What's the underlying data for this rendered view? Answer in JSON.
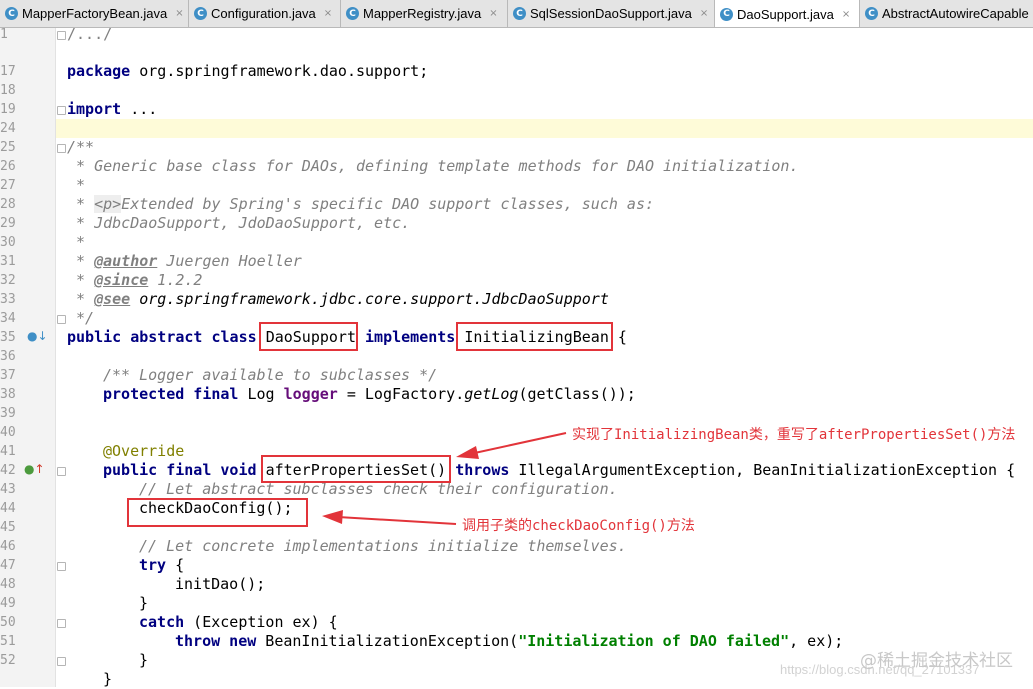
{
  "tabs": [
    {
      "label": "MapperFactoryBean.java",
      "icon": "C",
      "close": "×"
    },
    {
      "label": "Configuration.java",
      "icon": "C",
      "close": "×"
    },
    {
      "label": "MapperRegistry.java",
      "icon": "C",
      "close": "×"
    },
    {
      "label": "SqlSessionDaoSupport.java",
      "icon": "C",
      "close": "×"
    },
    {
      "label": "DaoSupport.java",
      "icon": "C",
      "close": "×"
    },
    {
      "label": "AbstractAutowireCapable",
      "icon": "C",
      "close": ""
    }
  ],
  "active_tab": "DaoSupport.java",
  "line_numbers": [
    "1",
    "17",
    "18",
    "19",
    "24",
    "25",
    "26",
    "27",
    "28",
    "29",
    "30",
    "31",
    "32",
    "33",
    "34",
    "35",
    "36",
    "37",
    "38",
    "39",
    "40",
    "41",
    "42",
    "43",
    "44",
    "45",
    "46",
    "47",
    "48",
    "49",
    "50",
    "51",
    "52"
  ],
  "code": {
    "l1": "/.../",
    "l17_kw": "package",
    "l17_rest": " org.springframework.dao.support;",
    "l19_kw": "import",
    "l19_rest": " ...",
    "l25": "/**",
    "l26": " * Generic base class for DAOs, defining template methods for DAO initialization.",
    "l27": " *",
    "l28_a": " * ",
    "l28_tag": "<p>",
    "l28_b": "Extended by Spring's specific DAO support classes, such as:",
    "l29": " * JdbcDaoSupport, JdoDaoSupport, etc.",
    "l30": " *",
    "l31_a": " * ",
    "l31_tag": "@author",
    "l31_b": " Juergen Hoeller",
    "l32_a": " * ",
    "l32_tag": "@since",
    "l32_b": " 1.2.2",
    "l33_a": " * ",
    "l33_tag": "@see",
    "l33_b": " org.springframework.jdbc.core.support.JdbcDaoSupport",
    "l34": " */",
    "l35_kw": "public abstract class",
    "l35_name": "DaoSupport",
    "l35_kw2": "implements",
    "l35_iface": "InitializingBean",
    "l35_brace": " {",
    "l37": "/** Logger available to subclasses */",
    "l38_kw": "protected final",
    "l38_type": " Log ",
    "l38_field": "logger",
    "l38_eq": " = LogFactory.",
    "l38_method": "getLog",
    "l38_rest": "(getClass());",
    "l41": "@Override",
    "l42_kw": "public final void",
    "l42_method": "afterPropertiesSet()",
    "l42_kw2": "throws",
    "l42_rest": " IllegalArgumentException, BeanInitializationException {",
    "l43": "// Let abstract subclasses check their configuration.",
    "l44": "checkDaoConfig();",
    "l46": "// Let concrete implementations initialize themselves.",
    "l47_kw": "try",
    "l47_rest": " {",
    "l48": "initDao();",
    "l49": "}",
    "l50_kw": "catch",
    "l50_rest": " (Exception ex) {",
    "l51_kw": "throw new",
    "l51_mid": " BeanInitializationException(",
    "l51_str": "\"Initialization of DAO failed\"",
    "l51_end": ", ex);",
    "l52": "}",
    "l53": "}"
  },
  "annotations": {
    "note1": "实现了InitializingBean类，重写了afterPropertiesSet()方法",
    "note2": "调用子类的checkDaoConfig()方法"
  },
  "watermark": "@稀土掘金技术社区",
  "url_watermark": "https://blog.csdn.net/qq_27101337",
  "colors": {
    "keyword": "#000080",
    "comment": "#808080",
    "string": "#008000",
    "field": "#660e7a",
    "annotation": "#808000",
    "highlight_box": "#e2343a",
    "caret_line": "#fefbd8"
  }
}
